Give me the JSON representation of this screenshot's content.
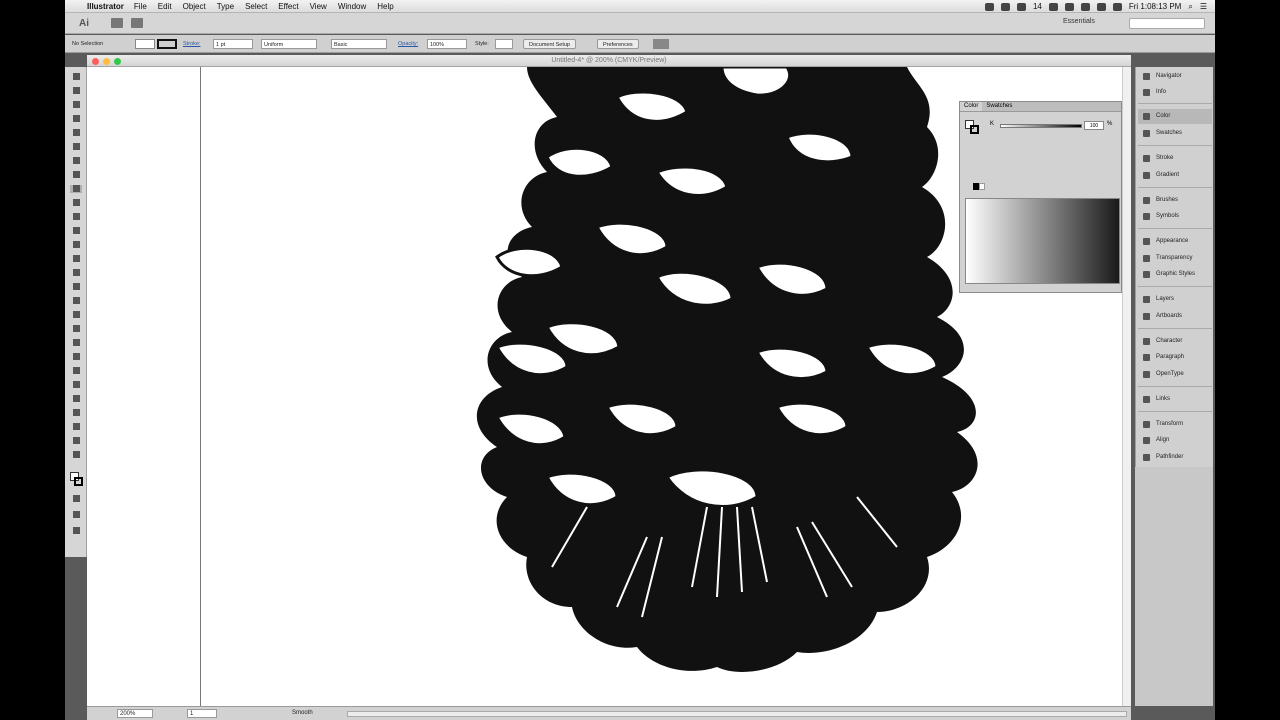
{
  "menubar": {
    "app_name": "Illustrator",
    "items": [
      "File",
      "Edit",
      "Object",
      "Type",
      "Select",
      "Effect",
      "View",
      "Window",
      "Help"
    ],
    "badge": "14",
    "clock": "Fri 1:08:13 PM"
  },
  "appbar": {
    "logo": "Ai",
    "workspace": "Essentials",
    "search_placeholder": ""
  },
  "control_bar": {
    "selection": "No Selection",
    "stroke_label": "Stroke:",
    "stroke_weight": "1 pt",
    "profile": "Uniform",
    "brush": "Basic",
    "opacity_label": "Opacity:",
    "opacity": "100%",
    "style_label": "Style:",
    "document_setup": "Document Setup",
    "preferences": "Preferences"
  },
  "document": {
    "title": "Untitled-4* @ 200% (CMYK/Preview)"
  },
  "statusbar": {
    "zoom": "200%",
    "artboard": "1",
    "tool": "Smooth"
  },
  "color_panel": {
    "tabs": [
      "Color",
      "Swatches"
    ],
    "k_label": "K",
    "k_value": "100",
    "percent": "%",
    "k_level_fraction": 1.0
  },
  "dock": {
    "items": [
      "Navigator",
      "Info",
      "Color",
      "Swatches",
      "Stroke",
      "Gradient",
      "Brushes",
      "Symbols",
      "Appearance",
      "Transparency",
      "Graphic Styles",
      "Layers",
      "Artboards",
      "Character",
      "Paragraph",
      "OpenType",
      "Links",
      "Transform",
      "Align",
      "Pathfinder"
    ],
    "selected": "Color"
  },
  "colors": {
    "accent": "#2858a8",
    "canvas": "#ffffff",
    "artwork": "#111111"
  }
}
